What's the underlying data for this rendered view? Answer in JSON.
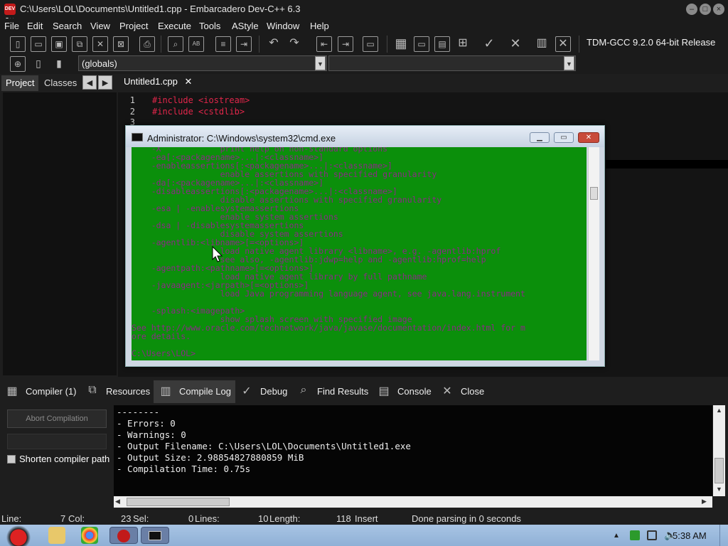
{
  "window": {
    "title": "C:\\Users\\LOL\\Documents\\Untitled1.cpp - Embarcadero Dev-C++ 6.3",
    "app_icon_text": "DEV C++"
  },
  "menu": [
    "File",
    "Edit",
    "Search",
    "View",
    "Project",
    "Execute",
    "Tools",
    "AStyle",
    "Window",
    "Help"
  ],
  "toolbar": {
    "compiler": "TDM-GCC 9.2.0 64-bit Release",
    "scope": "(globals)"
  },
  "left_tabs": [
    "Project",
    "Classes"
  ],
  "editor": {
    "tab_label": "Untitled1.cpp",
    "lines": [
      {
        "n": "1",
        "code": "#include <iostream>"
      },
      {
        "n": "2",
        "code": "#include <cstdlib>"
      },
      {
        "n": "3",
        "code": ""
      }
    ]
  },
  "cmd": {
    "title": "Administrator: C:\\Windows\\system32\\cmd.exe",
    "output": "    -X            print help on non-standard options\n    -ea[:<packagename>...|:<classname>]\n    -enableassertions[:<packagename>...|:<classname>]\n                  enable assertions with specified granularity\n    -da[:<packagename>...|:<classname>]\n    -disableassertions[:<packagename>...|:<classname>]\n                  disable assertions with specified granularity\n    -esa | -enablesystemassertions\n                  enable system assertions\n    -dsa | -disablesystemassertions\n                  disable system assertions\n    -agentlib:<libname>[=<options>]\n                  load native agent library <libname>, e.g. -agentlib:hprof\n                  see also, -agentlib:jdwp=help and -agentlib:hprof=help\n    -agentpath:<pathname>[=<options>]\n                  load native agent library by full pathname\n    -javaagent:<jarpath>[=<options>]\n                  load Java programming language agent, see java.lang.instrument\n\n    -splash:<imagepath>\n                  show splash screen with specified image\nSee http://www.oracle.com/technetwork/java/javase/documentation/index.html for m\nore details.\n\nC:\\Users\\LOL>"
  },
  "bottom_tabs": [
    {
      "label": "Compiler (1)",
      "icon": "grid-icon"
    },
    {
      "label": "Resources",
      "icon": "resources-icon"
    },
    {
      "label": "Compile Log",
      "icon": "chart-icon"
    },
    {
      "label": "Debug",
      "icon": "check-icon"
    },
    {
      "label": "Find Results",
      "icon": "find-icon"
    },
    {
      "label": "Console",
      "icon": "console-icon"
    },
    {
      "label": "Close",
      "icon": "close-icon"
    }
  ],
  "compile_panel": {
    "abort_label": "Abort Compilation",
    "shorten_label": "Shorten compiler path"
  },
  "compile_log": "--------\n- Errors: 0\n- Warnings: 0\n- Output Filename: C:\\Users\\LOL\\Documents\\Untitled1.exe\n- Output Size: 2.98854827880859 MiB\n- Compilation Time: 0.75s",
  "status": {
    "line_label": "Line:",
    "line_val": "7",
    "col_label": "Col:",
    "col_val": "23",
    "sel_label": "Sel:",
    "sel_val": "0",
    "lines_label": "Lines:",
    "lines_val": "10",
    "length_label": "Length:",
    "length_val": "118",
    "mode": "Insert",
    "message": "Done parsing in 0 seconds"
  },
  "taskbar": {
    "time": "5:38 AM"
  }
}
